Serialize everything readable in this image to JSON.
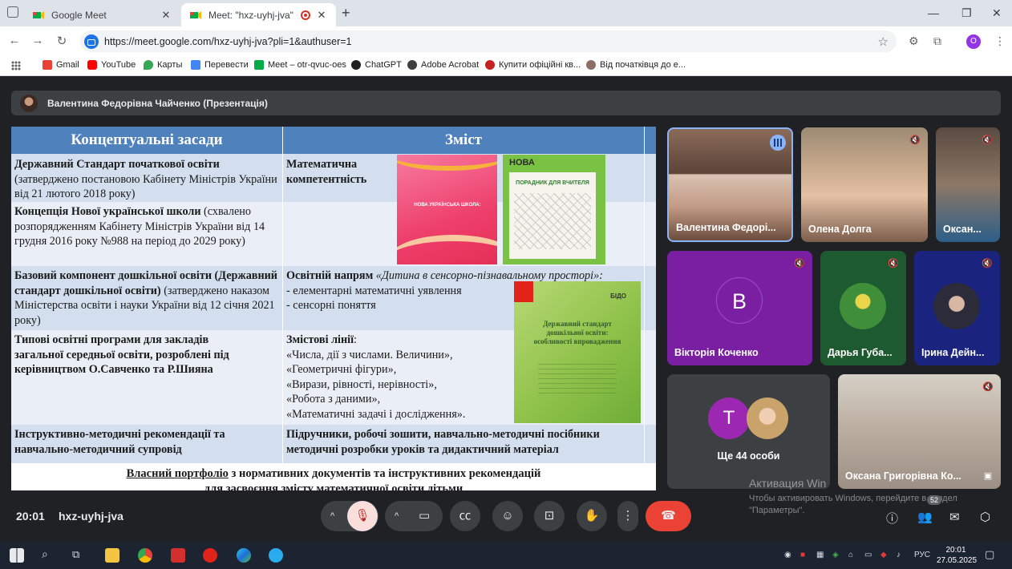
{
  "browser": {
    "tabs": [
      {
        "title": "Google Meet"
      },
      {
        "title": "Meet: \"hxz-uyhj-jva\""
      }
    ],
    "url": "https://meet.google.com/hxz-uyhj-jva?pli=1&authuser=1",
    "profile_initial": "O",
    "bookmarks": [
      "Gmail",
      "YouTube",
      "Карты",
      "Перевести",
      "Meet – otr-qvuc-oes",
      "ChatGPT",
      "Adobe Acrobat",
      "Купити офіційні кв...",
      "Від початківця до е..."
    ]
  },
  "meet": {
    "presenter_label": "Валентина Федорівна Чайченко (Презентація)",
    "time": "20:01",
    "meeting_code": "hxz-uyhj-jva",
    "people_badge": "52",
    "more_people": "Ще 44 особи",
    "tiles": [
      {
        "name": "Валентина Федорі..."
      },
      {
        "name": "Олена Долга"
      },
      {
        "name": "Оксан..."
      },
      {
        "name": "Вікторія Коченко",
        "initial": "B"
      },
      {
        "name": "Дарья Губа..."
      },
      {
        "name": "Ірина Дейн..."
      },
      {
        "name": "Оксана Григорівна Ко..."
      }
    ],
    "more_initial": "T"
  },
  "slide": {
    "header_left": "Концептуальні засади",
    "header_right": "Зміст",
    "r1_left_bold": "Державний Стандарт початкової освіти",
    "r1_left_rest": "(затверджено постановою Кабінету Міністрів України від 21 лютого 2018 року)",
    "r1_right": "Математична компетентність",
    "r2_left_bold": "Концепція Нової української школи",
    "r2_left_rest": "(схвалено розпорядженням Кабінету Міністрів України від 14 грудня 2016 року №988 на період до 2029 року)",
    "r3_left_bold": "Базовий компонент дошкільної освіти (Державний стандарт дошкільної освіти)",
    "r3_left_rest": "(затверджено наказом  Міністерства освіти і науки  України від 12 січня 2021 року)",
    "r3_right_bold": "Освітній напрям",
    "r3_right_italic": "«Дитина в сенсорно-пізнавальному просторі»:",
    "r3_right_l1": "- елементарні математичні уявлення",
    "r3_right_l2": "- сенсорні поняття",
    "r4_left": "Типові освітні програми для закладів загальної середньої освіти, розроблені під керівництвом О.Савченко та Р.Шияна",
    "r4_right_bold": "Змістові лінії",
    "r4_lines": [
      "«Числа, дії з числами. Величини»,",
      "«Геометричні фігури»,",
      "«Вирази, рівності, нерівності»,",
      "«Робота з даними»,",
      "«Математичні задачі і дослідження»."
    ],
    "r5_left": "Інструктивно-методичні рекомендації та навчально-методичний супровід",
    "r5_right": "Підручники, робочі зошити, навчально-методичні посібники методичні розробки уроків та дидактичний матеріал",
    "foot_underlined": "Власний портфоліо",
    "foot_rest": " з нормативних документів та інструктивних рекомендацій",
    "foot_line2": "для засвоєння змісту математичної освіти дітьми",
    "book1_title": "НОВА УКРАЇНСЬКА ШКОЛА:",
    "book2_brand": "НОВА",
    "book2_sub": "ПОРАДНИК ДЛЯ ВЧИТЕЛЯ",
    "book3_brand": "БІДО",
    "book3_title": "Державний стандарт дошкільної освіти: особливості впровадження"
  },
  "watermark": {
    "line1": "Активация Win",
    "line2": "Чтобы активировать Windows, перейдите в раздел \"Параметры\"."
  },
  "taskbar": {
    "lang": "РУС",
    "clock_time": "20:01",
    "clock_date": "27.05.2025"
  }
}
